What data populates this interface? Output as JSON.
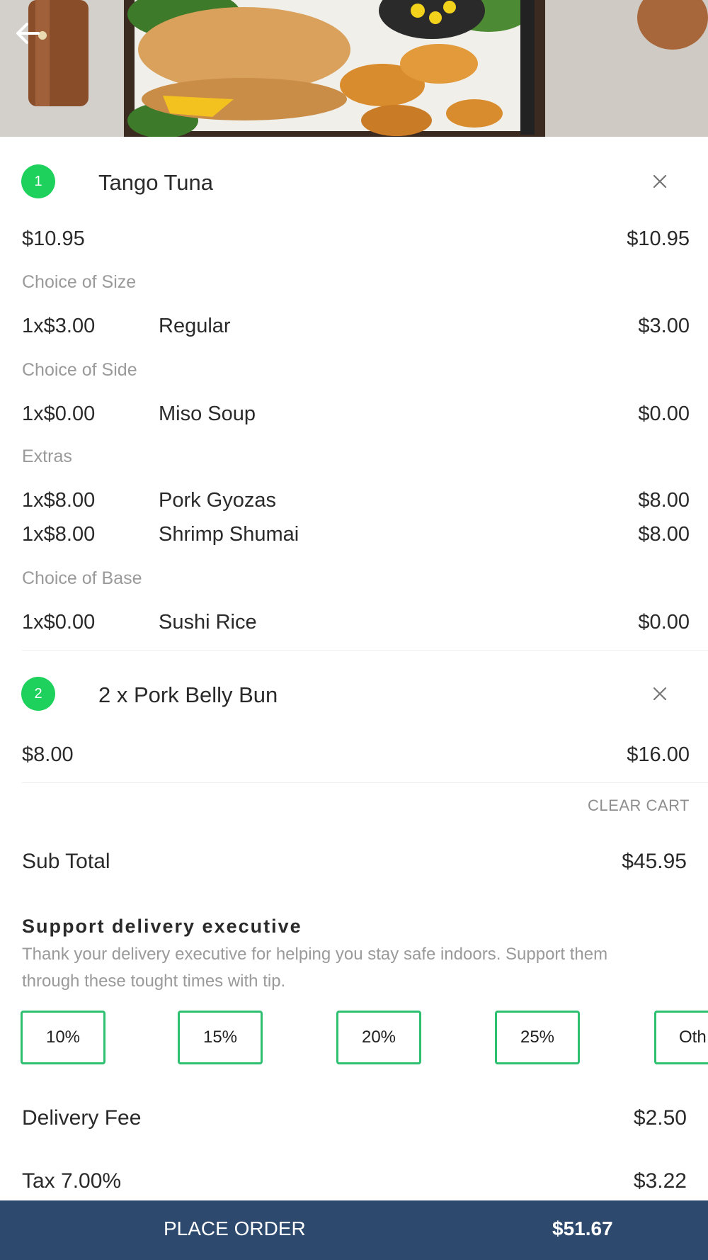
{
  "header": {
    "back_icon": "arrow-left-icon",
    "hero_image": "food-photo"
  },
  "cart": {
    "items": [
      {
        "number": "1",
        "title": "Tango Tuna",
        "base_price": "$10.95",
        "base_total": "$10.95",
        "groups": [
          {
            "label": "Choice of Size",
            "options": [
              {
                "qty": "1x$3.00",
                "name": "Regular",
                "amount": "$3.00"
              }
            ]
          },
          {
            "label": "Choice of Side",
            "options": [
              {
                "qty": "1x$0.00",
                "name": "Miso Soup",
                "amount": "$0.00"
              }
            ]
          },
          {
            "label": "Extras",
            "options": [
              {
                "qty": "1x$8.00",
                "name": "Pork Gyozas",
                "amount": "$8.00"
              },
              {
                "qty": "1x$8.00",
                "name": "Shrimp Shumai",
                "amount": "$8.00"
              }
            ]
          },
          {
            "label": "Choice of Base",
            "options": [
              {
                "qty": "1x$0.00",
                "name": "Sushi Rice",
                "amount": "$0.00"
              }
            ]
          }
        ]
      },
      {
        "number": "2",
        "title": "2 x Pork Belly Bun",
        "base_price": "$8.00",
        "base_total": "$16.00"
      }
    ],
    "clear_cart_label": "CLEAR CART"
  },
  "summary": {
    "subtotal_label": "Sub Total",
    "subtotal_value": "$45.95",
    "delivery_label": "Delivery Fee",
    "delivery_value": "$2.50",
    "tax_label": "Tax 7.00%",
    "tax_value": "$3.22"
  },
  "tip": {
    "title": "Support delivery executive",
    "description": "Thank your delivery executive for helping you stay safe indoors. Support them through these tought times with tip.",
    "options": [
      "10%",
      "15%",
      "20%",
      "25%",
      "Oth"
    ]
  },
  "footer": {
    "place_order_label": "PLACE ORDER",
    "total": "$51.67"
  },
  "colors": {
    "accent_green": "#1ed15c",
    "tip_border": "#2fbf71",
    "bottom_bar": "#2d4a6e"
  }
}
